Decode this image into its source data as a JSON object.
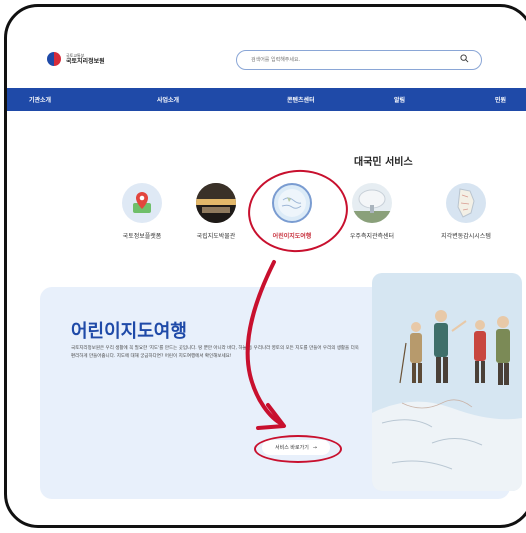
{
  "header": {
    "logo_sub": "국토교통부",
    "logo_main": "국토지리정보원",
    "search_placeholder": "검색어를 입력해주세요."
  },
  "nav": {
    "items": [
      "기관소개",
      "사업소개",
      "콘텐츠센터",
      "알림",
      "민원"
    ]
  },
  "services": {
    "title": "대국민 서비스",
    "items": [
      {
        "label": "국토정보플랫폼",
        "icon": "map-pin-icon"
      },
      {
        "label": "국립지도박물관",
        "icon": "museum-icon"
      },
      {
        "label": "어린이지도여행",
        "icon": "globe-icon",
        "active": true
      },
      {
        "label": "우주측지관측센터",
        "icon": "satellite-dish-icon"
      },
      {
        "label": "지각변동감시시스템",
        "icon": "map-icon"
      }
    ]
  },
  "banner": {
    "title": "어린이지도여행",
    "desc": "국토지리정보원은 우리 생활에 꼭 필요한 '지도'를 만드는 곳입니다. 땅 뿐만 아니라 바다, 하늘 등 우리나라 영토의 모든 지도를 만들어 우리의 생활을 더욱 편리하게 만들어줍니다. 지도에 대해 궁금하다면? 어린이 지도여행에서 확인해보세요!",
    "button_label": "서비스 바로가기",
    "button_arrow": "→"
  },
  "colors": {
    "nav": "#1f4aa8",
    "highlight": "#c8102e",
    "banner_bg": "#e8f0fb"
  }
}
